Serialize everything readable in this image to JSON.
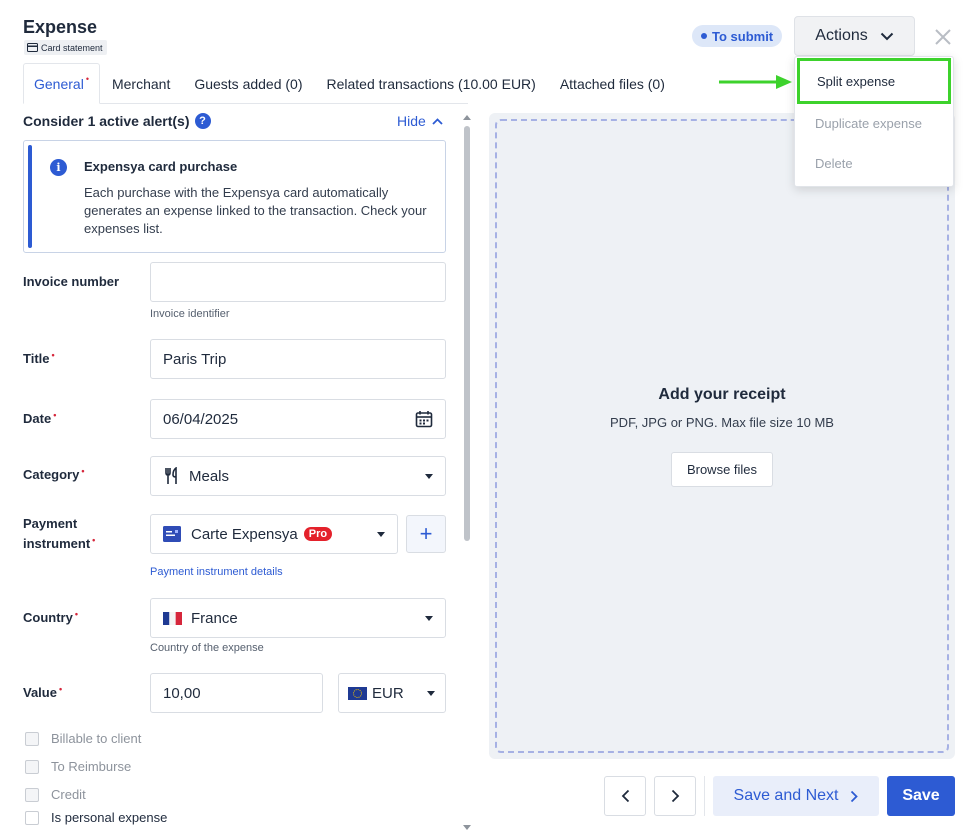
{
  "header": {
    "title": "Expense",
    "card_tag": "Card statement",
    "status": "To submit",
    "actions_label": "Actions"
  },
  "actions_menu": {
    "items": [
      {
        "label": "Split expense",
        "enabled": true
      },
      {
        "label": "Duplicate expense",
        "enabled": false
      },
      {
        "label": "Delete",
        "enabled": false
      }
    ]
  },
  "tabs": [
    {
      "label": "General",
      "active": true,
      "required": true
    },
    {
      "label": "Merchant"
    },
    {
      "label": "Guests added (0)"
    },
    {
      "label": "Related transactions (10.00 EUR)"
    },
    {
      "label": "Attached files (0)"
    }
  ],
  "alerts": {
    "heading": "Consider 1 active alert(s)",
    "help": "?",
    "hide_label": "Hide",
    "card_title": "Expensya card purchase",
    "card_text": "Each purchase with the Expensya card automatically generates an expense linked to the transaction. Check your expenses list.",
    "info_glyph": "i"
  },
  "form": {
    "required_mark": "•",
    "invoice": {
      "label": "Invoice number",
      "value": "",
      "hint": "Invoice identifier"
    },
    "title": {
      "label": "Title",
      "value": "Paris Trip"
    },
    "date": {
      "label": "Date",
      "value": "06/04/2025"
    },
    "category": {
      "label": "Category",
      "value": "Meals"
    },
    "payment": {
      "label_line1": "Payment",
      "label_line2": "instrument",
      "value": "Carte Expensya",
      "badge": "Pro",
      "link": "Payment instrument details",
      "add": "+"
    },
    "country": {
      "label": "Country",
      "value": "France",
      "hint": "Country of the expense"
    },
    "value": {
      "label": "Value",
      "amount": "10,00",
      "currency": "EUR"
    },
    "checkboxes": [
      {
        "label": "Billable to client",
        "enabled": false
      },
      {
        "label": "To Reimburse",
        "enabled": false
      },
      {
        "label": "Credit",
        "enabled": false
      },
      {
        "label": "Is personal expense",
        "enabled": true
      }
    ]
  },
  "receipt": {
    "title": "Add your receipt",
    "subtitle": "PDF, JPG or PNG. Max file size 10 MB",
    "browse_label": "Browse files"
  },
  "footer": {
    "save_next_label": "Save and Next",
    "save_label": "Save"
  },
  "colors": {
    "accent": "#2d5bd3",
    "highlight": "#3dd22c",
    "required": "#d6263b",
    "pro_badge": "#e4212b"
  }
}
